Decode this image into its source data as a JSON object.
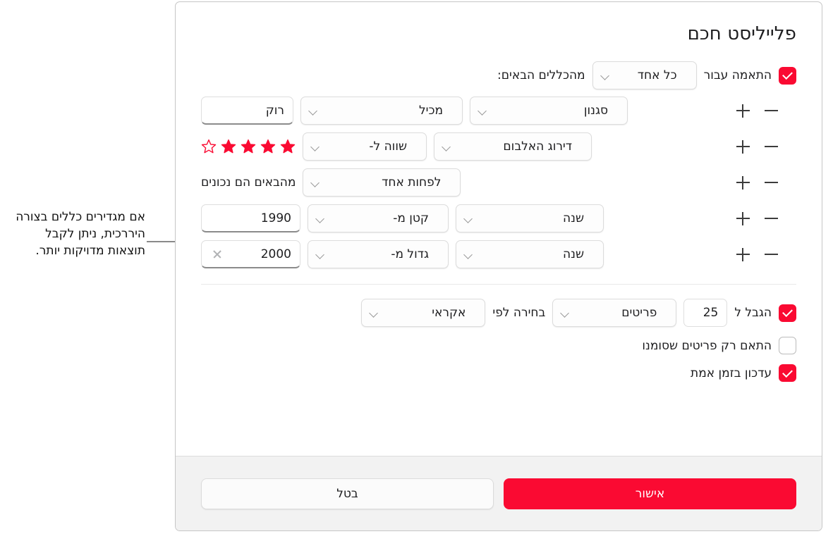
{
  "dialog": {
    "title": "פלייליסט חכם",
    "match": {
      "checked": true,
      "prefix": "התאמה עבור",
      "selector": "כל אחד",
      "suffix": "מהכללים הבאים:"
    },
    "rules": [
      {
        "field": "סגנון",
        "operator": "מכיל",
        "value": "רוק",
        "value_type": "text",
        "minus": "−",
        "plus": "+",
        "more": "•••"
      },
      {
        "field": "דירוג האלבום",
        "operator": "שווה ל-",
        "value_type": "stars",
        "stars_filled": 4,
        "stars_total": 5,
        "minus": "−",
        "plus": "+",
        "more": "•••"
      },
      {
        "field": "לפחות אחד",
        "operator": "מהבאים הם נכונים",
        "value_type": "group",
        "minus": "−",
        "plus": "+",
        "more": "•••"
      },
      {
        "field": "שנה",
        "operator": "קטן מ-",
        "value": "1990",
        "value_type": "text",
        "minus": "−",
        "plus": "+",
        "more": "•••"
      },
      {
        "field": "שנה",
        "operator": "גדול מ-",
        "value": "2000",
        "value_type": "text_clear",
        "clear_icon": "×",
        "minus": "−",
        "plus": "+",
        "more": "•••"
      }
    ],
    "limit": {
      "checked": true,
      "label": "הגבל ל",
      "amount": "25",
      "unit": "פריטים",
      "by_label": "בחירה לפי",
      "by_value": "אקראי"
    },
    "only_checked": {
      "checked": false,
      "label": "התאם רק פריטים שסומנו"
    },
    "live_update": {
      "checked": true,
      "label": "עדכון בזמן אמת"
    },
    "buttons": {
      "ok": "אישור",
      "cancel": "בטל"
    }
  },
  "annotation": {
    "text": "אם מגדירים כללים בצורה היררכית, ניתן לקבל תוצאות מדויקות יותר."
  },
  "colors": {
    "accent": "#FA0A32",
    "footer_bg": "#F2F2F2",
    "text": "#1D1D1F",
    "border": "#DCDCDC"
  }
}
